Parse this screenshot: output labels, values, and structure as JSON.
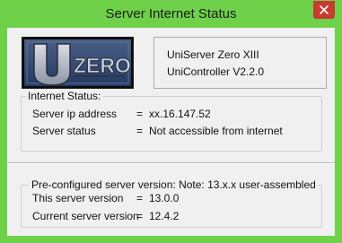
{
  "window": {
    "title": "Server Internet Status"
  },
  "about": {
    "product": "UniServer Zero XIII",
    "controller": "UniController V2.2.0"
  },
  "internet_status": {
    "label": "Internet Status:",
    "rows": [
      {
        "label": "Server ip address",
        "eq": "=",
        "value": "xx.16.147.52"
      },
      {
        "label": "Server status",
        "eq": "=",
        "value": "Not accessible from internet"
      }
    ]
  },
  "version": {
    "label": "Pre-configured server version: Note: 13.x.x user-assembled",
    "rows": [
      {
        "label": "This server version",
        "eq": "=",
        "value": "13.0.0"
      },
      {
        "label": "Current server version",
        "eq": "=",
        "value": "12.4.2"
      }
    ]
  },
  "colors": {
    "frame": "#6fd14a",
    "close_button": "#c83b2f",
    "client": "#f0f0f0"
  },
  "icons": {
    "close": "close-icon",
    "logo": "uzero-logo"
  }
}
